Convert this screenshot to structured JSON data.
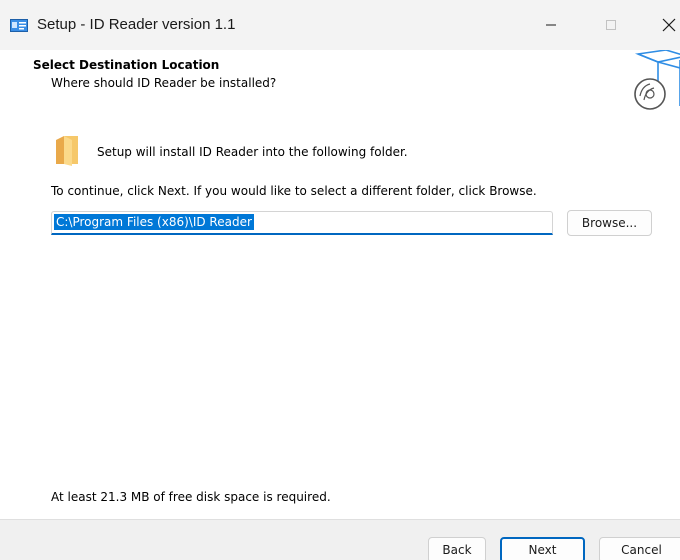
{
  "window": {
    "title": "Setup - ID Reader version 1.1"
  },
  "header": {
    "title": "Select Destination Location",
    "subtitle": "Where should ID Reader be installed?"
  },
  "content": {
    "install_text": "Setup will install ID Reader into the following folder.",
    "continue_text": "To continue, click Next. If you would like to select a different folder, click Browse.",
    "path_value": "C:\\Program Files (x86)\\ID Reader",
    "browse_label": "Browse...",
    "disk_space_text": "At least 21.3 MB of free disk space is required."
  },
  "footer": {
    "back_label": "Back",
    "next_label": "Next",
    "cancel_label": "Cancel"
  },
  "colors": {
    "accent": "#0067c0",
    "selection": "#0078d7",
    "folder": "#f6c86a"
  }
}
